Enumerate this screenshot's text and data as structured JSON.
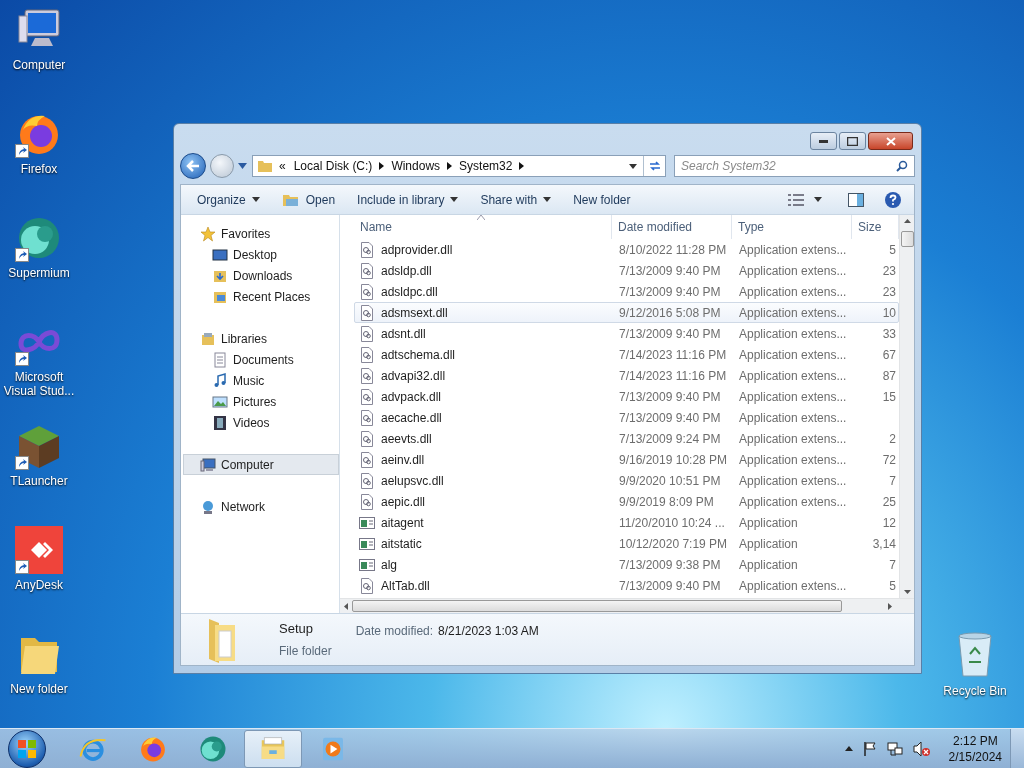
{
  "desktop_icons": [
    {
      "label": "Computer",
      "kind": "computer",
      "shortcut": false
    },
    {
      "label": "Firefox",
      "kind": "firefox",
      "shortcut": true
    },
    {
      "label": "Supermium",
      "kind": "supermium",
      "shortcut": true
    },
    {
      "label": "Microsoft Visual Stud...",
      "kind": "infinity",
      "shortcut": true
    },
    {
      "label": "TLauncher",
      "kind": "grass-block",
      "shortcut": true
    },
    {
      "label": "AnyDesk",
      "kind": "anydesk",
      "shortcut": true
    },
    {
      "label": "New folder",
      "kind": "folder",
      "shortcut": false
    }
  ],
  "recycle_bin": {
    "label": "Recycle Bin"
  },
  "window": {
    "address": {
      "overflow": "«",
      "crumbs": [
        "Local Disk (C:)",
        "Windows",
        "System32"
      ]
    },
    "search": {
      "placeholder": "Search System32"
    },
    "toolbar": [
      {
        "label": "Organize",
        "kind": "menu"
      },
      {
        "label": "Open",
        "kind": "open"
      },
      {
        "label": "Include in library",
        "kind": "menu"
      },
      {
        "label": "Share with",
        "kind": "menu"
      },
      {
        "label": "New folder",
        "kind": "button"
      }
    ],
    "nav": [
      {
        "label": "Favorites",
        "kind": "star",
        "group": true,
        "selected": false
      },
      {
        "label": "Desktop",
        "kind": "desktop",
        "group": false,
        "selected": false
      },
      {
        "label": "Downloads",
        "kind": "downloads",
        "group": false,
        "selected": false
      },
      {
        "label": "Recent Places",
        "kind": "recent",
        "group": false,
        "selected": false
      },
      {
        "label": "Libraries",
        "kind": "library",
        "group": true,
        "selected": false
      },
      {
        "label": "Documents",
        "kind": "documents",
        "group": false,
        "selected": false
      },
      {
        "label": "Music",
        "kind": "music",
        "group": false,
        "selected": false
      },
      {
        "label": "Pictures",
        "kind": "pictures",
        "group": false,
        "selected": false
      },
      {
        "label": "Videos",
        "kind": "videos",
        "group": false,
        "selected": false
      },
      {
        "label": "Computer",
        "kind": "computer",
        "group": true,
        "selected": true
      },
      {
        "label": "Network",
        "kind": "network",
        "group": true,
        "selected": false
      }
    ],
    "columns": [
      "Name",
      "Date modified",
      "Type",
      "Size"
    ],
    "rows": [
      {
        "name": "adprovider.dll",
        "date": "8/10/2022 11:28 PM",
        "type": "Application extens...",
        "size": "5",
        "kind": "dll",
        "selected": false
      },
      {
        "name": "adsldp.dll",
        "date": "7/13/2009 9:40 PM",
        "type": "Application extens...",
        "size": "23",
        "kind": "dll",
        "selected": false
      },
      {
        "name": "adsldpc.dll",
        "date": "7/13/2009 9:40 PM",
        "type": "Application extens...",
        "size": "23",
        "kind": "dll",
        "selected": false
      },
      {
        "name": "adsmsext.dll",
        "date": "9/12/2016 5:08 PM",
        "type": "Application extens...",
        "size": "10",
        "kind": "dll",
        "selected": true
      },
      {
        "name": "adsnt.dll",
        "date": "7/13/2009 9:40 PM",
        "type": "Application extens...",
        "size": "33",
        "kind": "dll",
        "selected": false
      },
      {
        "name": "adtschema.dll",
        "date": "7/14/2023 11:16 PM",
        "type": "Application extens...",
        "size": "67",
        "kind": "dll",
        "selected": false
      },
      {
        "name": "advapi32.dll",
        "date": "7/14/2023 11:16 PM",
        "type": "Application extens...",
        "size": "87",
        "kind": "dll",
        "selected": false
      },
      {
        "name": "advpack.dll",
        "date": "7/13/2009 9:40 PM",
        "type": "Application extens...",
        "size": "15",
        "kind": "dll",
        "selected": false
      },
      {
        "name": "aecache.dll",
        "date": "7/13/2009 9:40 PM",
        "type": "Application extens...",
        "kind": "dll",
        "selected": false
      },
      {
        "name": "aeevts.dll",
        "date": "7/13/2009 9:24 PM",
        "type": "Application extens...",
        "size": "2",
        "kind": "dll",
        "selected": false
      },
      {
        "name": "aeinv.dll",
        "date": "9/16/2019 10:28 PM",
        "type": "Application extens...",
        "size": "72",
        "kind": "dll",
        "selected": false
      },
      {
        "name": "aelupsvc.dll",
        "date": "9/9/2020 10:51 PM",
        "type": "Application extens...",
        "size": "7",
        "kind": "dll",
        "selected": false
      },
      {
        "name": "aepic.dll",
        "date": "9/9/2019 8:09 PM",
        "type": "Application extens...",
        "size": "25",
        "kind": "dll",
        "selected": false
      },
      {
        "name": "aitagent",
        "date": "11/20/2010 10:24 ...",
        "type": "Application",
        "size": "12",
        "kind": "exe",
        "selected": false
      },
      {
        "name": "aitstatic",
        "date": "10/12/2020 7:19 PM",
        "type": "Application",
        "size": "3,14",
        "kind": "exe",
        "selected": false
      },
      {
        "name": "alg",
        "date": "7/13/2009 9:38 PM",
        "type": "Application",
        "size": "7",
        "kind": "exe",
        "selected": false
      },
      {
        "name": "AltTab.dll",
        "date": "7/13/2009 9:40 PM",
        "type": "Application extens...",
        "size": "5",
        "kind": "dll",
        "selected": false
      }
    ],
    "details": {
      "name": "Setup",
      "type": "File folder",
      "date_label": "Date modified:",
      "date": "8/21/2023 1:03 AM"
    }
  },
  "taskbar": {
    "apps": [
      {
        "kind": "ie",
        "active": false
      },
      {
        "kind": "firefox",
        "active": false
      },
      {
        "kind": "supermium",
        "active": false
      },
      {
        "kind": "explorer",
        "active": true
      },
      {
        "kind": "media",
        "active": false
      }
    ],
    "time": "2:12 PM",
    "date": "2/15/2024"
  }
}
